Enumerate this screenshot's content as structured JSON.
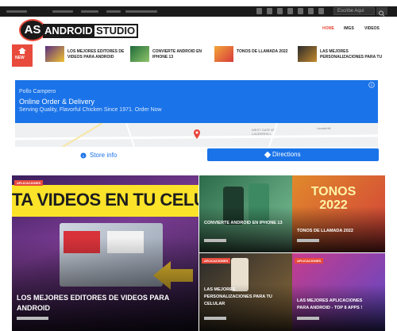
{
  "topbar": {
    "search_placeholder": "Escribe Aquí"
  },
  "logo": {
    "monogram": "AS",
    "word1": "ANDROID",
    "word2": "STUDIO"
  },
  "nav": {
    "items": [
      {
        "label": "HOME",
        "active": true
      },
      {
        "label": "IMGS",
        "active": false
      },
      {
        "label": "VIDEOS",
        "active": false
      }
    ]
  },
  "ticker": {
    "badge": "NEW",
    "items": [
      {
        "title": "LOS MEJORES EDITORES DE VIDEOS PARA ANDROID"
      },
      {
        "title": "CONVIERTE ANDROID EN IPHONE 13"
      },
      {
        "title": "TONOS DE LLAMADA 2022"
      },
      {
        "title": "LAS MEJORES PERSONALIZACIONES PARA TU"
      }
    ]
  },
  "ad": {
    "brand": "Pollo Campero",
    "title": "Online Order & Delivery",
    "description": "Serving Quality, Flavorful Chicken Since 1971. Order Now",
    "store_label": "Store info",
    "directions_label": "Directions",
    "map_labels": [
      "WEST GATE AT LAUDERHILL",
      "Lauderhill"
    ]
  },
  "cards": {
    "big": {
      "category": "APLICACIONES",
      "banner": "TA VIDEOS EN TU CELU",
      "title": "LOS MEJORES EDITORES DE VIDEOS PARA ANDROID"
    },
    "c1": {
      "title": "CONVIERTE ANDROID EN IPHONE 13"
    },
    "c2": {
      "banner": "TONOS 2022",
      "title": "TONOS DE LLAMADA 2022"
    },
    "c3": {
      "category": "APLICACIONES",
      "title_line1": "LAS MEJORES",
      "title_line2": "PERSONALIZACIONES PARA TU",
      "title_line3": "CELULAR"
    },
    "c4": {
      "category": "APLICACIONES",
      "title_line1": "LAS MEJORES APLICACIONES",
      "title_line2": "PARA ANDROID - TOP 8 APPS !"
    }
  },
  "colors": {
    "accent": "#e84b3c",
    "ad_blue": "#1a73e8",
    "topbar": "#1b1b1b"
  }
}
